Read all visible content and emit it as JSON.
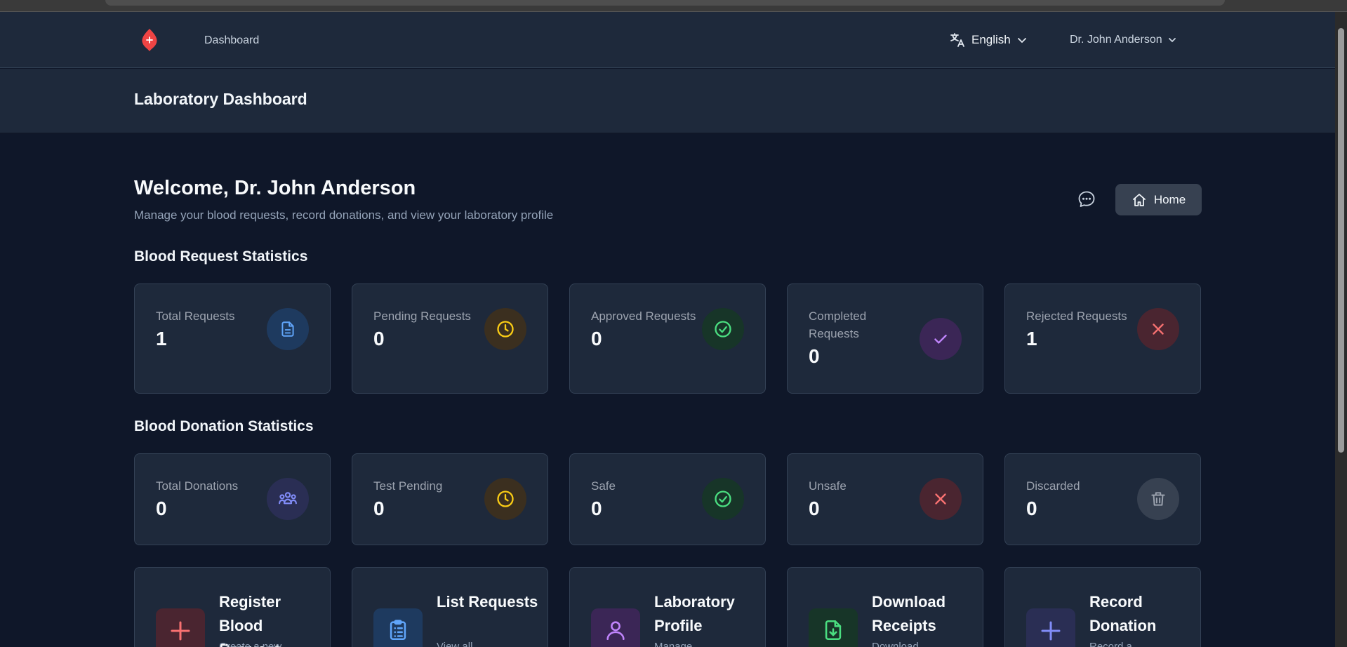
{
  "nav": {
    "dashboard": "Dashboard",
    "language": "English",
    "user": "Dr. John Anderson"
  },
  "header": {
    "title": "Laboratory Dashboard"
  },
  "welcome": {
    "title": "Welcome, Dr. John Anderson",
    "subtitle": "Manage your blood requests, record donations, and view your laboratory profile"
  },
  "home_button": "Home",
  "request_stats": {
    "title": "Blood Request Statistics",
    "cards": [
      {
        "label": "Total Requests",
        "value": "1",
        "icon": "document-icon"
      },
      {
        "label": "Pending Requests",
        "value": "0",
        "icon": "clock-icon"
      },
      {
        "label": "Approved Requests",
        "value": "0",
        "icon": "check-circle-icon"
      },
      {
        "label": "Completed Requests",
        "value": "0",
        "icon": "check-icon"
      },
      {
        "label": "Rejected Requests",
        "value": "1",
        "icon": "x-icon"
      }
    ]
  },
  "donation_stats": {
    "title": "Blood Donation Statistics",
    "cards": [
      {
        "label": "Total Donations",
        "value": "0",
        "icon": "users-icon"
      },
      {
        "label": "Test Pending",
        "value": "0",
        "icon": "clock-icon"
      },
      {
        "label": "Safe",
        "value": "0",
        "icon": "check-circle-icon"
      },
      {
        "label": "Unsafe",
        "value": "0",
        "icon": "x-icon"
      },
      {
        "label": "Discarded",
        "value": "0",
        "icon": "trash-icon"
      }
    ]
  },
  "actions": [
    {
      "title": "Register Blood Request",
      "desc": "Create a new",
      "icon": "plus-icon"
    },
    {
      "title": "List Requests",
      "desc": "View all",
      "icon": "clipboard-icon"
    },
    {
      "title": "Laboratory Profile",
      "desc": "Manage",
      "icon": "user-icon"
    },
    {
      "title": "Download Receipts",
      "desc": "Download",
      "icon": "file-download-icon"
    },
    {
      "title": "Record Donation",
      "desc": "Record a",
      "icon": "plus-icon"
    }
  ],
  "colors": {
    "background": "#0f1729",
    "panel": "#1e293b",
    "border": "#334155",
    "blue": "#60a5fa",
    "amber": "#facc15",
    "green": "#4ade80",
    "purple": "#c084fc",
    "red": "#f87171",
    "indigo": "#818cf8",
    "gray": "#9ca3af"
  }
}
